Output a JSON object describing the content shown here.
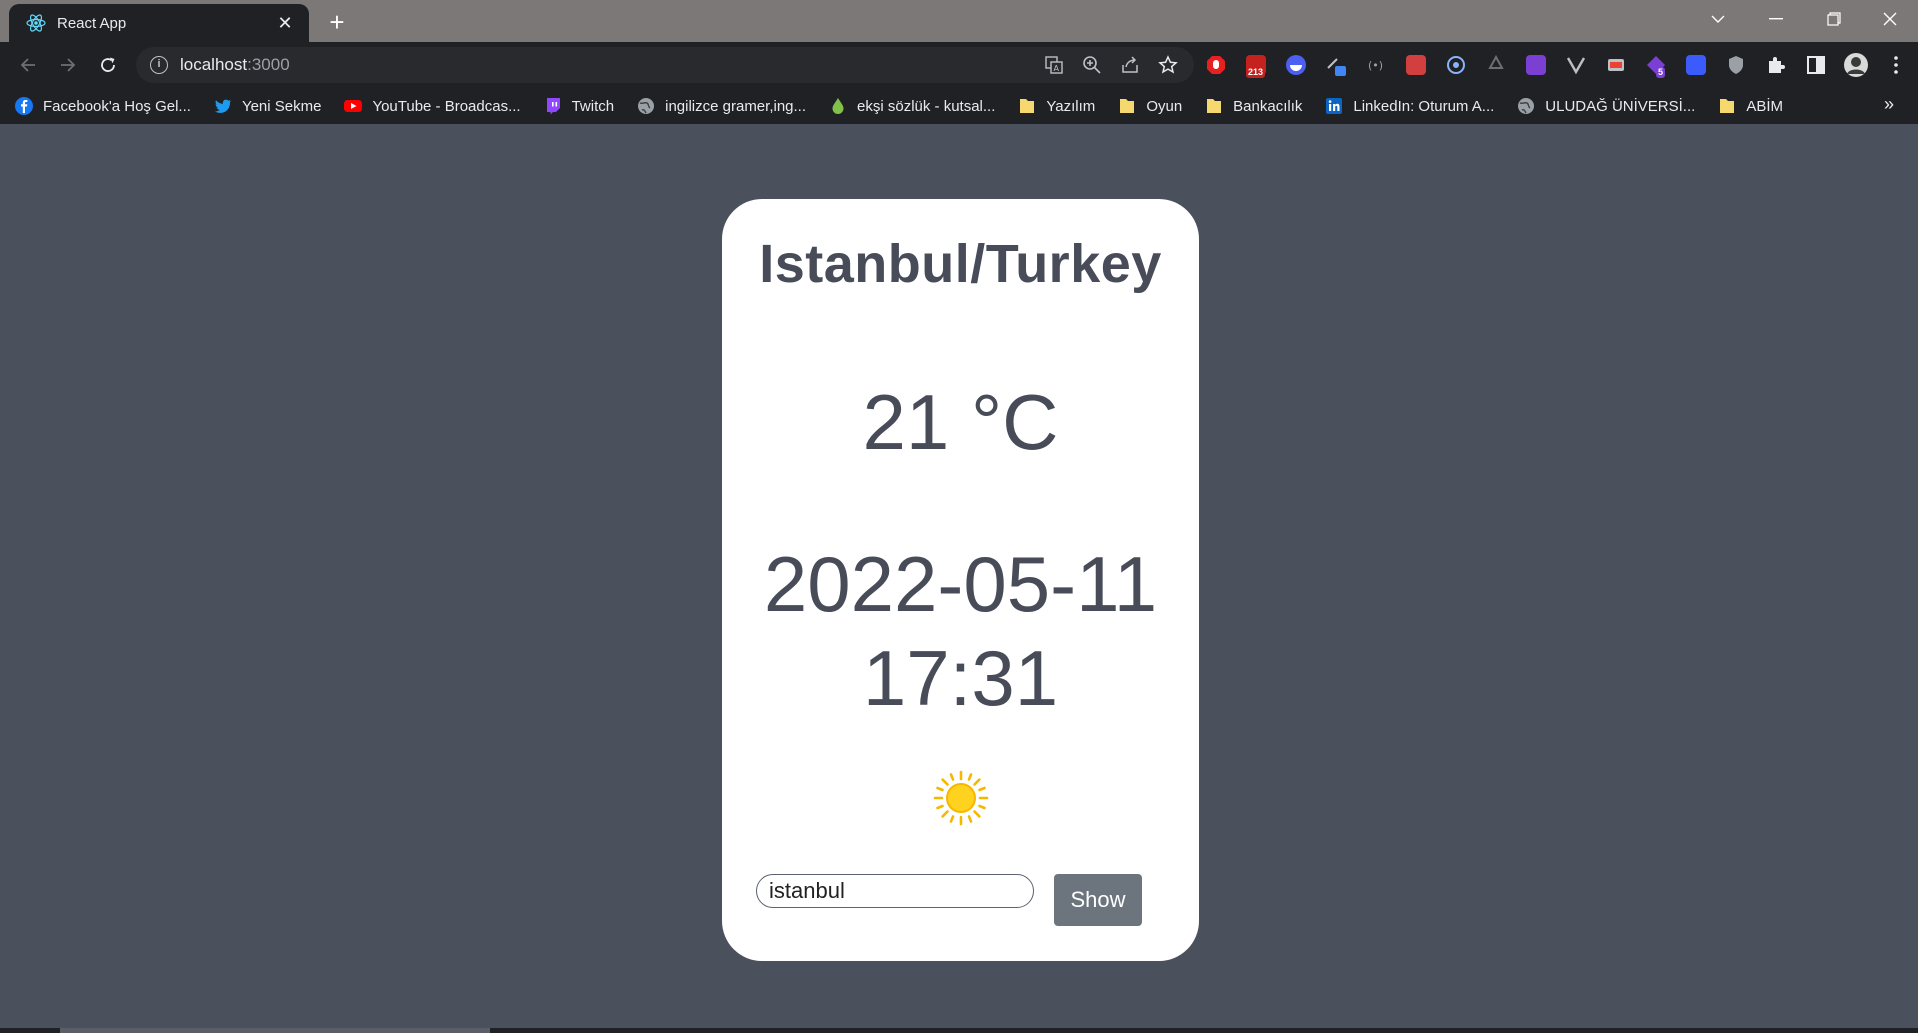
{
  "browser": {
    "tab_title": "React App",
    "new_tab_symbol": "+",
    "url_host": "localhost",
    "url_port": ":3000"
  },
  "bookmarks": [
    {
      "label": "Facebook'a Hoş Gel...",
      "icon": "facebook-icon",
      "color": "#1877f2"
    },
    {
      "label": "Yeni Sekme",
      "icon": "twitter-icon",
      "color": "#1d9bf0"
    },
    {
      "label": "YouTube - Broadcas...",
      "icon": "youtube-icon",
      "color": "#ff0000"
    },
    {
      "label": "Twitch",
      "icon": "twitch-icon",
      "color": "#9146ff"
    },
    {
      "label": "ingilizce gramer,ing...",
      "icon": "globe-icon",
      "color": "#9aa0a6"
    },
    {
      "label": "ekşi sözlük - kutsal...",
      "icon": "drop-icon",
      "color": "#81c14b"
    },
    {
      "label": "Yazılım",
      "icon": "folder-icon",
      "color": "#f6d96e"
    },
    {
      "label": "Oyun",
      "icon": "folder-icon",
      "color": "#f6d96e"
    },
    {
      "label": "Bankacılık",
      "icon": "folder-icon",
      "color": "#f6d96e"
    },
    {
      "label": "LinkedIn: Oturum A...",
      "icon": "linkedin-icon",
      "color": "#0a66c2"
    },
    {
      "label": "ULUDAĞ ÜNİVERSİ...",
      "icon": "globe-icon",
      "color": "#9aa0a6"
    },
    {
      "label": "ABİM",
      "icon": "folder-icon",
      "color": "#f6d96e"
    }
  ],
  "extensions": {
    "mail_badge": "213",
    "ext_badge": "5"
  },
  "weather": {
    "city": "Istanbul/Turkey",
    "temperature": "21 °C",
    "date": "2022-05-11",
    "time": "17:31",
    "condition_icon": "sun-icon",
    "search_value": "istanbul",
    "button_label": "Show"
  },
  "colors": {
    "page_bg": "#4a505c",
    "card_bg": "#ffffff",
    "text": "#474c58",
    "button_bg": "#6c757d"
  }
}
